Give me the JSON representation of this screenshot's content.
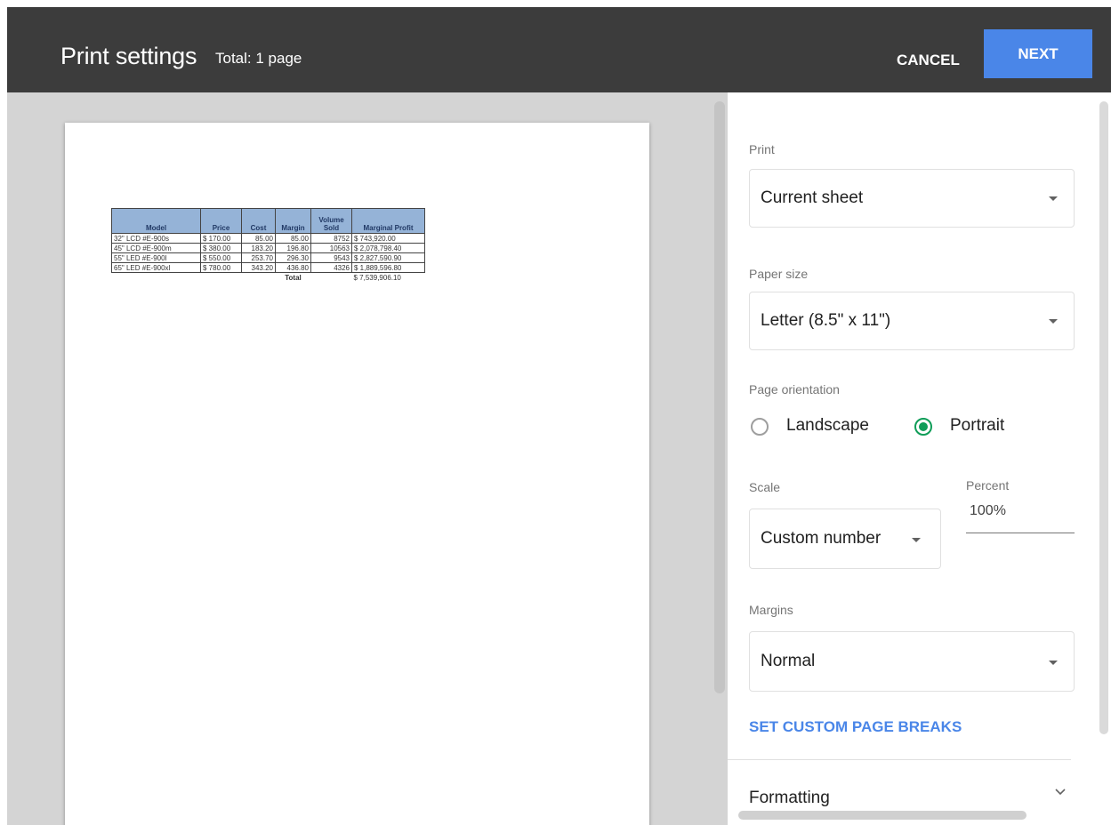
{
  "header": {
    "title": "Print settings",
    "total": "Total: 1 page",
    "cancel_label": "CANCEL",
    "next_label": "NEXT"
  },
  "sheet": {
    "columns": [
      "Model",
      "Price",
      "Cost",
      "Margin",
      "Volume Sold",
      "Marginal Profit"
    ],
    "rows": [
      [
        "32\" LCD #E-900s",
        "$ 170.00",
        "85.00",
        "85.00",
        "8752",
        "$ 743,920.00"
      ],
      [
        "45\" LCD #E-900m",
        "$ 380.00",
        "183.20",
        "196.80",
        "10563",
        "$ 2,078,798.40"
      ],
      [
        "55\" LED #E-900l",
        "$ 550.00",
        "253.70",
        "296.30",
        "9543",
        "$ 2,827,590.90"
      ],
      [
        "65\" LED #E-900xl",
        "$ 780.00",
        "343.20",
        "436.80",
        "4326",
        "$ 1,889,596.80"
      ]
    ],
    "total_label": "Total",
    "total_value": "$ 7,539,906.10",
    "header_color": "#95b3d7"
  },
  "settings": {
    "print_label": "Print",
    "print_value": "Current sheet",
    "paper_label": "Paper size",
    "paper_value": "Letter (8.5\" x 11\")",
    "orientation_label": "Page orientation",
    "landscape_label": "Landscape",
    "portrait_label": "Portrait",
    "selected_orientation": "Portrait",
    "scale_label": "Scale",
    "scale_value": "Custom number",
    "percent_label": "Percent",
    "percent_value": "100%",
    "margins_label": "Margins",
    "margins_value": "Normal",
    "page_breaks_link": "SET CUSTOM PAGE BREAKS",
    "formatting_label": "Formatting",
    "accent_color": "#4a86e8",
    "radio_color": "#0f9d58"
  },
  "icons": [
    "dropdown-caret-icon",
    "radio-selected-icon",
    "chevron-down-icon"
  ]
}
